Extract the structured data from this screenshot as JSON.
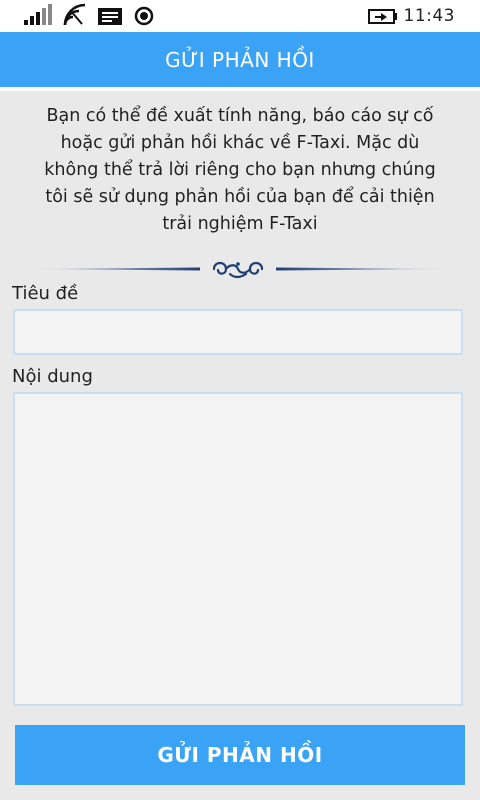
{
  "status_bar": {
    "time": "11:43",
    "icons": [
      "signal-icon",
      "wifi-icon",
      "message-icon",
      "location-icon",
      "battery-charging-icon"
    ]
  },
  "header": {
    "title": "GỬI PHẢN HỒI"
  },
  "intro": {
    "lines": [
      "Bạn có thể đề xuất tính năng, báo cáo sự cố",
      "hoặc gửi phản hồi khác về F-Taxi. Mặc dù",
      "không thể trả lời riêng cho bạn nhưng chúng",
      "tôi sẽ sử dụng phản hồi của bạn để cải thiện",
      "trải nghiệm F-Taxi"
    ]
  },
  "form": {
    "title_label": "Tiêu đề",
    "title_value": "",
    "content_label": "Nội dung",
    "content_value": ""
  },
  "submit_label": "GỬI PHẢN HỒI",
  "colors": {
    "accent": "#3aa3f5",
    "background": "#e9e9ea",
    "input_border": "#c9dff1",
    "ornament": "#1f3f73"
  }
}
